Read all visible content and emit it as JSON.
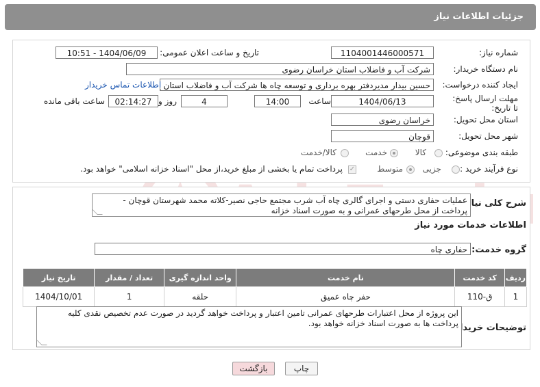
{
  "header": {
    "title": "جزئیات اطلاعات نیاز"
  },
  "labels": {
    "need_number": "شماره نیاز:",
    "announce_datetime": "تاریخ و ساعت اعلان عمومی:",
    "buyer_org": "نام دستگاه خریدار:",
    "requester": "ایجاد کننده درخواست:",
    "deadline": "مهلت ارسال پاسخ: تا تاریخ:",
    "time_word": "ساعت",
    "days_word": "روز و",
    "remaining_word": "ساعت باقی مانده",
    "province": "استان محل تحویل:",
    "city": "شهر محل تحویل:",
    "category": "طبقه بندی موضوعی:",
    "process_type": "نوع فرآیند خرید :",
    "need_summary": "شرح کلی نیاز:",
    "services_info": "اطلاعات خدمات مورد نیاز",
    "service_group": "گروه خدمت:",
    "buyer_notes": "توضیحات خریدار:"
  },
  "fields": {
    "need_number": "1104001446000571",
    "announce_datetime": "1404/06/09 - 10:51",
    "buyer_org": "شرکت آب و فاضلاب استان خراسان رضوی",
    "requester": "حسین  بیدار مدیردفتر بهره برداری و توسعه چاه ها شرکت آب و فاضلاب استان خ",
    "contact_link": "اطلاعات تماس خریدار",
    "deadline_date": "1404/06/13",
    "deadline_time": "14:00",
    "days_left": "4",
    "time_left": "02:14:27",
    "province": "خراسان رضوی",
    "city": "قوچان",
    "service_group": "حفاری چاه"
  },
  "category_options": [
    {
      "label": "کالا",
      "selected": false
    },
    {
      "label": "خدمت",
      "selected": true
    },
    {
      "label": "کالا/خدمت",
      "selected": false
    }
  ],
  "process_options": [
    {
      "label": "جزیی",
      "selected": false
    },
    {
      "label": "متوسط",
      "selected": true
    }
  ],
  "payment_note": "پرداخت تمام یا بخشی از مبلغ خرید،از محل \"اسناد خزانه اسلامی\" خواهد بود.",
  "need_summary_text": "عملیات حفاری دستی و اجرای گالری چاه آب شرب مجتمع حاجی نصیر-کلاته محمد شهرستان قوچان - پرداخت از محل طرحهای عمرانی و به صورت اسناد خزانه",
  "table": {
    "headers": [
      "ردیف",
      "کد خدمت",
      "نام خدمت",
      "واحد اندازه گیری",
      "تعداد / مقدار",
      "تاریخ نیاز"
    ],
    "rows": [
      [
        "1",
        "ق-110",
        "حفر چاه عمیق",
        "حلقه",
        "1",
        "1404/10/01"
      ]
    ]
  },
  "buyer_notes_text": "این پروژه از محل اعتبارات طرحهای عمرانی تامین اعتبار و پرداخت خواهد گردید در صورت عدم تخصیص نقدی کلیه پرداخت ها به صورت اسناد خزانه خواهد بود.",
  "buttons": {
    "print": "چاپ",
    "back": "بازگشت"
  },
  "watermark": "AriaTender.neT",
  "colors": {
    "header_bg": "#8f8f8f",
    "table_header_bg": "#7c7c7c",
    "link": "#1a55b0",
    "back_button_bg": "#f6d9dc"
  }
}
